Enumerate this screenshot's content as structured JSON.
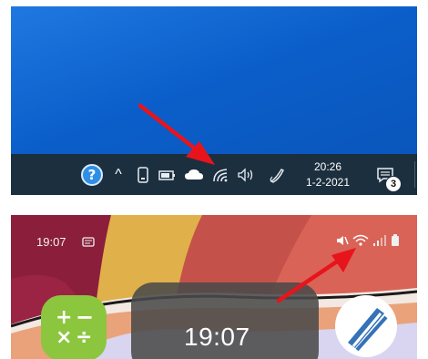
{
  "windows": {
    "taskbar": {
      "help_label": "?",
      "chevron": "^",
      "clock_time": "20:26",
      "clock_date": "1-2-2021",
      "notification_count": "3",
      "tray_icons": [
        "help-icon",
        "chevron-up-icon",
        "phone-icon",
        "battery-icon",
        "cloud-icon",
        "wifi-icon",
        "volume-icon",
        "pen-icon",
        "notification-icon"
      ]
    }
  },
  "android": {
    "status_time": "19:07",
    "clock_time": "19:07",
    "status_icons": [
      "notification-dot-icon",
      "mute-icon",
      "wifi-icon",
      "signal-icon",
      "battery-icon"
    ],
    "apps": [
      "calculator-app-icon",
      "blade-app-icon"
    ]
  },
  "colors": {
    "desktop_blue": "#0b5ec9",
    "taskbar": "#1c2f3f",
    "arrow_red": "#e8141c",
    "calculator_green": "#8cc63f"
  }
}
